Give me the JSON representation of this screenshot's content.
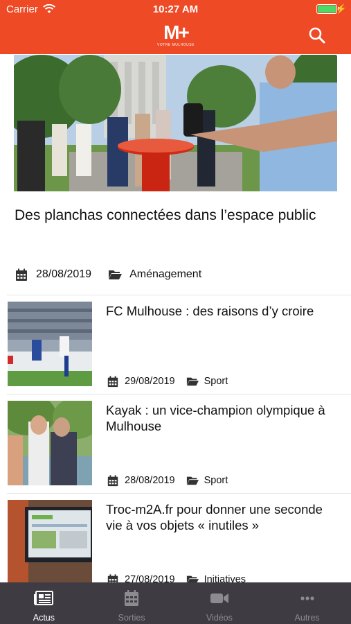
{
  "status_bar": {
    "carrier": "Carrier",
    "time": "10:27 AM",
    "battery_level": 1.0
  },
  "header": {
    "logo_text": "M+",
    "logo_subtitle": "VOTRE MULHOUSE",
    "icons": {
      "search": "search-icon"
    }
  },
  "colors": {
    "brand": "#ee4a26",
    "tabbar_bg": "#3f3b42",
    "tab_inactive": "#8e8a90",
    "tab_active": "#ffffff",
    "battery": "#4cd964"
  },
  "feature": {
    "image": "feature-photo",
    "title": "Des planchas connectées dans l’espace public",
    "date": "28/08/2019",
    "category": "Aménagement"
  },
  "articles": [
    {
      "title": "FC Mulhouse : des raisons d’y croire",
      "date": "29/08/2019",
      "category": "Sport",
      "image": "football-photo"
    },
    {
      "title": "Kayak : un vice-champion olympique à Mulhouse",
      "date": "28/08/2019",
      "category": "Sport",
      "image": "group-photo"
    },
    {
      "title": "Troc-m2A.fr pour donner une seconde vie à vos objets « inutiles »",
      "date": "27/08/2019",
      "category": "Initiatives",
      "image": "computer-screen-photo"
    }
  ],
  "tabbar": {
    "tabs": [
      {
        "label": "Actus",
        "icon": "newspaper-icon",
        "active": true
      },
      {
        "label": "Sorties",
        "icon": "calendar-icon",
        "active": false
      },
      {
        "label": "Vidéos",
        "icon": "video-camera-icon",
        "active": false
      },
      {
        "label": "Autres",
        "icon": "more-dots-icon",
        "active": false
      }
    ]
  }
}
